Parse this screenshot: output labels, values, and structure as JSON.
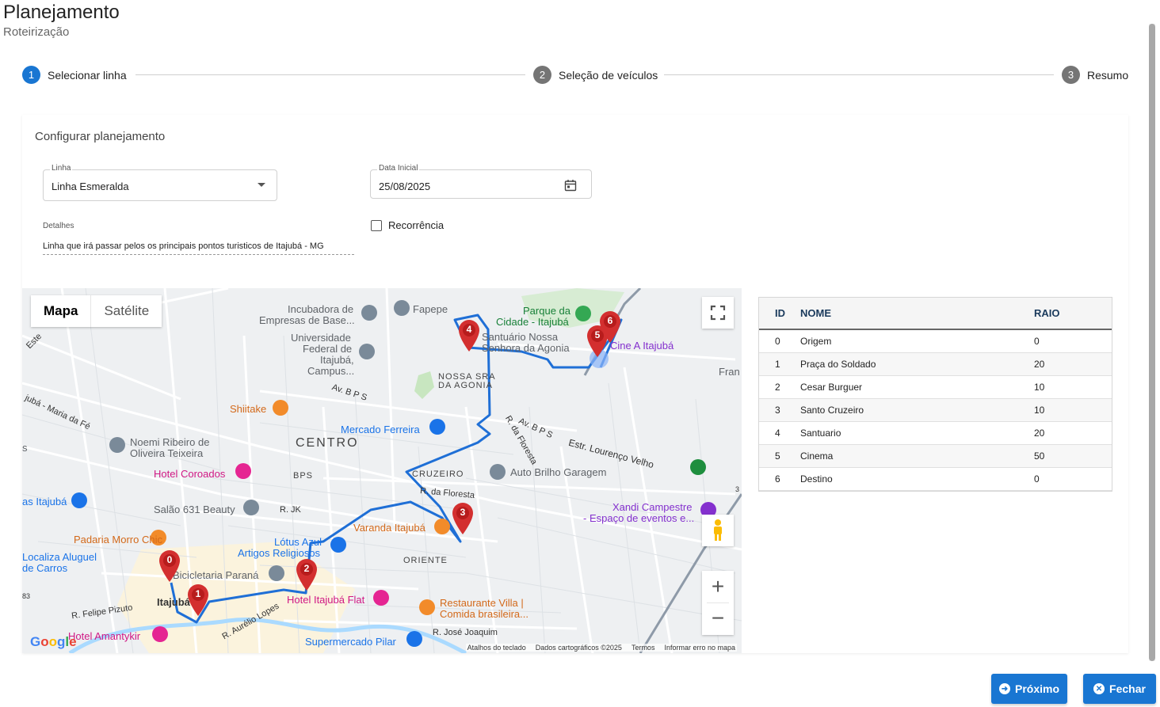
{
  "header": {
    "title": "Planejamento",
    "subtitle": "Roteirização"
  },
  "stepper": {
    "steps": [
      {
        "number": "1",
        "label": "Selecionar linha",
        "active": true
      },
      {
        "number": "2",
        "label": "Seleção de veículos",
        "active": false
      },
      {
        "number": "3",
        "label": "Resumo",
        "active": false
      }
    ]
  },
  "config": {
    "title": "Configurar planejamento",
    "linha": {
      "label": "Linha",
      "value": "Linha Esmeralda"
    },
    "data_inicial": {
      "label": "Data Inicial",
      "value": "25/08/2025"
    },
    "detalhes": {
      "label": "Detalhes",
      "value": "Linha que irá passar pelos os principais pontos turisticos de Itajubá - MG"
    },
    "recorrencia": {
      "label": "Recorrência",
      "checked": false
    }
  },
  "map": {
    "type_options": [
      "Mapa",
      "Satélite"
    ],
    "selected_type": "Mapa",
    "zoom_in": "+",
    "zoom_out": "−",
    "footer": [
      "Atalhos do teclado",
      "Dados cartográficos ©2025",
      "Termos",
      "Informar erro no mapa"
    ],
    "google_letters": [
      "G",
      "o",
      "o",
      "g",
      "l",
      "e"
    ],
    "labels": {
      "incubadora": "Incubadora de",
      "incubadora2": "Empresas de Base...",
      "fapepe": "Fapepe",
      "parque1": "Parque da",
      "parque2": "Cidade - Itajubá",
      "universidade1": "Universidade",
      "universidade2": "Federal de",
      "universidade3": "Itajubá,",
      "universidade4": "Campus...",
      "santuario1": "Santuário Nossa",
      "santuario2": "Senhora da Agonia",
      "cine": "Cine A Itajubá",
      "fran": "Fran",
      "nossa_sra1": "NOSSA SRA",
      "nossa_sra2": "DA AGONIA",
      "shiitake": "Shiitake",
      "avbps1": "Av. B P S",
      "avbps2": "Av. B P S",
      "centro": "CENTRO",
      "mercado": "Mercado Ferreira",
      "rfloresta1": "R. da Floresta",
      "estr": "Estr. Lourenço Velho",
      "noemi1": "Noemi Ribeiro de",
      "noemi2": "Oliveira Teixeira",
      "hotel_coroados": "Hotel Coroados",
      "bps": "BPS",
      "cruzeiro": "CRUZEIRO",
      "auto_brilho": "Auto Brilho Garagem",
      "itajuba_left": "as Itajubá",
      "salao": "Salão 631 Beauty",
      "rjk": "R. JK",
      "rfloresta2": "R. da Floresta",
      "xandi1": "Xandi Campestre",
      "xandi2": "- Espaço de eventos e...",
      "varanda": "Varanda Itajubá",
      "padaria": "Padaria Morro Chic",
      "lotus1": "Lótus Azul",
      "lotus2": "Artigos Religiosos",
      "localiza1": "Localiza Aluguel",
      "localiza2": "de Carros",
      "oriente": "ORIENTE",
      "bicicletaria": "Bicicletaria Paraná",
      "hotel_flat": "Hotel Itajubá Flat",
      "itajuba_center": "Itajubá",
      "restaurante1": "Restaurante Villa |",
      "restaurante2": "Comida brasileira...",
      "felipe": "R. Felipe Pizuto",
      "aurelio": "R. Aurélio Lopes",
      "jose": "R. José Joaquim",
      "hotel_amantykir": "Hotel Amantykir",
      "supermercado": "Supermercado Pilar",
      "maria": "jubá - Maria da Fé",
      "este": "Este",
      "s_left": "s",
      "n83": "83",
      "n3": "3"
    },
    "markers": [
      "0",
      "1",
      "2",
      "3",
      "4",
      "5",
      "6"
    ]
  },
  "table": {
    "headers": {
      "id": "ID",
      "nome": "NOME",
      "raio": "RAIO"
    },
    "rows": [
      {
        "id": "0",
        "nome": "Origem",
        "raio": "0"
      },
      {
        "id": "1",
        "nome": "Praça do Soldado",
        "raio": "20"
      },
      {
        "id": "2",
        "nome": "Cesar Burguer",
        "raio": "10"
      },
      {
        "id": "3",
        "nome": "Santo Cruzeiro",
        "raio": "10"
      },
      {
        "id": "4",
        "nome": "Santuario",
        "raio": "20"
      },
      {
        "id": "5",
        "nome": "Cinema",
        "raio": "50"
      },
      {
        "id": "6",
        "nome": "Destino",
        "raio": "0"
      }
    ]
  },
  "actions": {
    "next": "Próximo",
    "close": "Fechar"
  },
  "colors": {
    "primary": "#1976d2",
    "route": "#1f6fd6",
    "marker": "#d32f2f",
    "step_inactive": "#757575"
  }
}
